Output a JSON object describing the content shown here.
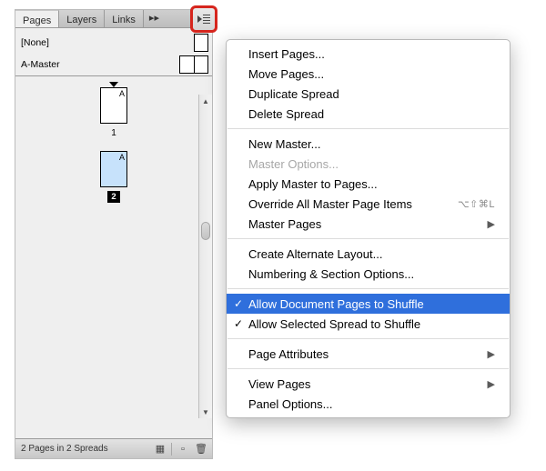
{
  "panel": {
    "tabs": [
      "Pages",
      "Layers",
      "Links"
    ],
    "activeTab": 0,
    "flyoutIconName": "flyout-menu-icon",
    "masters": [
      {
        "label": "[None]",
        "type": "single"
      },
      {
        "label": "A-Master",
        "type": "spread"
      }
    ],
    "pages": [
      {
        "letter": "A",
        "num": "1",
        "marker": true,
        "selected": false,
        "badge": false
      },
      {
        "letter": "A",
        "num": "2",
        "marker": false,
        "selected": true,
        "badge": true
      }
    ],
    "status": "2 Pages in 2 Spreads",
    "statusIcons": [
      "grid-icon",
      "new-page-icon",
      "trash-icon"
    ]
  },
  "menu": {
    "groups": [
      [
        {
          "label": "Insert Pages...",
          "type": "item"
        },
        {
          "label": "Move Pages...",
          "type": "item"
        },
        {
          "label": "Duplicate Spread",
          "type": "item"
        },
        {
          "label": "Delete Spread",
          "type": "item"
        }
      ],
      [
        {
          "label": "New Master...",
          "type": "item"
        },
        {
          "label": "Master Options...",
          "type": "item",
          "disabled": true
        },
        {
          "label": "Apply Master to Pages...",
          "type": "item"
        },
        {
          "label": "Override All Master Page Items",
          "type": "item",
          "shortcut": "⌥⇧⌘L"
        },
        {
          "label": "Master Pages",
          "type": "submenu"
        }
      ],
      [
        {
          "label": "Create Alternate Layout...",
          "type": "item"
        },
        {
          "label": "Numbering & Section Options...",
          "type": "item"
        }
      ],
      [
        {
          "label": "Allow Document Pages to Shuffle",
          "type": "item",
          "checked": true,
          "selected": true
        },
        {
          "label": "Allow Selected Spread to Shuffle",
          "type": "item",
          "checked": true
        }
      ],
      [
        {
          "label": "Page Attributes",
          "type": "submenu"
        }
      ],
      [
        {
          "label": "View Pages",
          "type": "submenu"
        },
        {
          "label": "Panel Options...",
          "type": "item"
        }
      ]
    ]
  }
}
